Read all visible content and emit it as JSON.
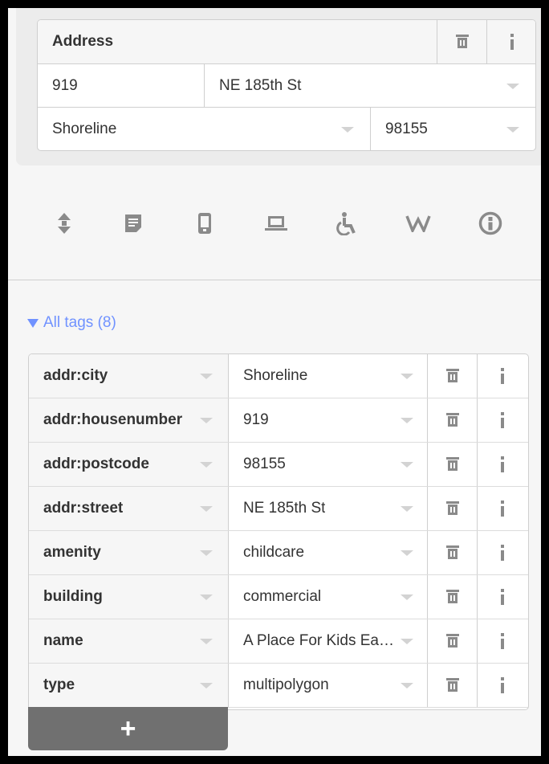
{
  "address": {
    "label": "Address",
    "housenumber": "919",
    "street": "NE 185th St",
    "city": "Shoreline",
    "postcode": "98155"
  },
  "icon_row": [
    {
      "name": "elevation-icon"
    },
    {
      "name": "note-icon"
    },
    {
      "name": "phone-icon"
    },
    {
      "name": "website-icon"
    },
    {
      "name": "wheelchair-icon"
    },
    {
      "name": "wikipedia-icon"
    },
    {
      "name": "info-circle-icon"
    }
  ],
  "all_tags": {
    "label": "All tags (8)"
  },
  "tags": [
    {
      "key": "addr:city",
      "value": "Shoreline"
    },
    {
      "key": "addr:housenumber",
      "value": "919"
    },
    {
      "key": "addr:postcode",
      "value": "98155"
    },
    {
      "key": "addr:street",
      "value": "NE 185th St"
    },
    {
      "key": "amenity",
      "value": "childcare"
    },
    {
      "key": "building",
      "value": "commercial"
    },
    {
      "key": "name",
      "value": "A Place For Kids Ea…"
    },
    {
      "key": "type",
      "value": "multipolygon"
    }
  ],
  "add_button": {
    "label": "+"
  },
  "colors": {
    "accent": "#7092ff",
    "border": "#cfcfcf",
    "add_button": "#707070"
  }
}
